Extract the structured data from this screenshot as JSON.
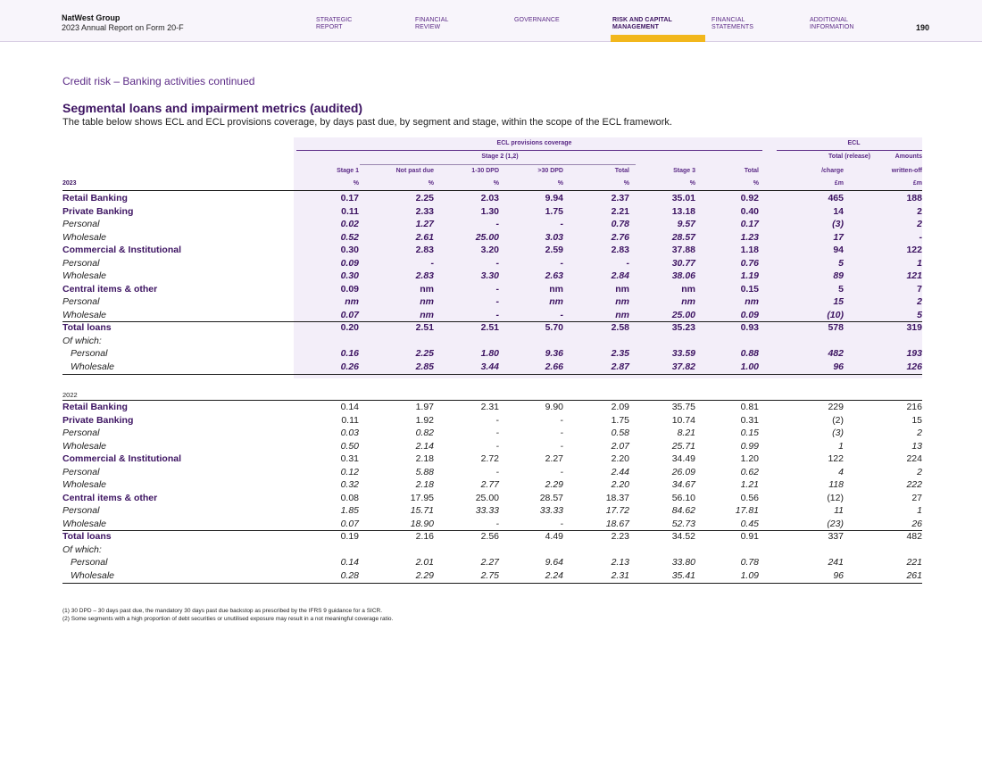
{
  "header": {
    "company": "NatWest Group",
    "report": "2023 Annual Report on Form 20-F",
    "page_number": "190",
    "nav": [
      {
        "label_1": "STRATEGIC",
        "label_2": "REPORT"
      },
      {
        "label_1": "FINANCIAL",
        "label_2": "REVIEW"
      },
      {
        "label_1": "",
        "label_2": "GOVERNANCE"
      },
      {
        "label_1": "RISK AND CAPITAL",
        "label_2": "MANAGEMENT"
      },
      {
        "label_1": "FINANCIAL",
        "label_2": "STATEMENTS"
      },
      {
        "label_1": "ADDITIONAL",
        "label_2": "INFORMATION"
      }
    ],
    "active_color": "#f2b71c"
  },
  "section_title": "Credit risk – Banking activities continued",
  "table_title": "Segmental loans and impairment metrics (audited)",
  "table_desc": "The table below shows ECL and ECL provisions coverage, by days past due, by segment and stage, within the scope of the ECL framework.",
  "table": {
    "group_ecl_coverage": "ECL provisions coverage",
    "group_stage2": "Stage 2 (1,2)",
    "group_ecl": "ECL",
    "columns": [
      {
        "h1": "",
        "h2": "Stage 1",
        "unit": "%"
      },
      {
        "h1": "",
        "h2": "Not past due",
        "unit": "%"
      },
      {
        "h1": "",
        "h2": "1-30 DPD",
        "unit": "%"
      },
      {
        "h1": "",
        "h2": ">30 DPD",
        "unit": "%"
      },
      {
        "h1": "",
        "h2": "Total",
        "unit": "%"
      },
      {
        "h1": "",
        "h2": "Stage 3",
        "unit": "%"
      },
      {
        "h1": "",
        "h2": "Total",
        "unit": "%"
      },
      {
        "h1": "Total (release)",
        "h2": "/charge",
        "unit": "£m"
      },
      {
        "h1": "Amounts",
        "h2": "written-off",
        "unit": "£m"
      }
    ],
    "year_2023": "2023",
    "year_2022": "2022",
    "rows_2023": [
      {
        "label": "Retail Banking",
        "type": "seg",
        "values": [
          "0.17",
          "2.25",
          "2.03",
          "9.94",
          "2.37",
          "35.01",
          "0.92",
          "465",
          "188"
        ]
      },
      {
        "label": "Private Banking",
        "type": "seg",
        "values": [
          "0.11",
          "2.33",
          "1.30",
          "1.75",
          "2.21",
          "13.18",
          "0.40",
          "14",
          "2"
        ]
      },
      {
        "label": "Personal",
        "type": "sub",
        "values": [
          "0.02",
          "1.27",
          "-",
          "-",
          "0.78",
          "9.57",
          "0.17",
          "(3)",
          "2"
        ]
      },
      {
        "label": "Wholesale",
        "type": "sub",
        "values": [
          "0.52",
          "2.61",
          "25.00",
          "3.03",
          "2.76",
          "28.57",
          "1.23",
          "17",
          "-"
        ]
      },
      {
        "label": "Commercial & Institutional",
        "type": "seg",
        "values": [
          "0.30",
          "2.83",
          "3.20",
          "2.59",
          "2.83",
          "37.88",
          "1.18",
          "94",
          "122"
        ]
      },
      {
        "label": "Personal",
        "type": "sub",
        "values": [
          "0.09",
          "-",
          "-",
          "-",
          "-",
          "30.77",
          "0.76",
          "5",
          "1"
        ]
      },
      {
        "label": "Wholesale",
        "type": "sub",
        "values": [
          "0.30",
          "2.83",
          "3.30",
          "2.63",
          "2.84",
          "38.06",
          "1.19",
          "89",
          "121"
        ]
      },
      {
        "label": "Central items & other",
        "type": "seg",
        "values": [
          "0.09",
          "nm",
          "-",
          "nm",
          "nm",
          "nm",
          "0.15",
          "5",
          "7"
        ]
      },
      {
        "label": "Personal",
        "type": "sub",
        "values": [
          "nm",
          "nm",
          "-",
          "nm",
          "nm",
          "nm",
          "nm",
          "15",
          "2"
        ]
      },
      {
        "label": "Wholesale",
        "type": "sub",
        "values": [
          "0.07",
          "nm",
          "-",
          "-",
          "nm",
          "25.00",
          "0.09",
          "(10)",
          "5"
        ]
      },
      {
        "label": "Total loans",
        "type": "seg",
        "values": [
          "0.20",
          "2.51",
          "2.51",
          "5.70",
          "2.58",
          "35.23",
          "0.93",
          "578",
          "319"
        ]
      },
      {
        "label": "Of which:",
        "type": "ofwhich",
        "values": [
          "",
          "",
          "",
          "",
          "",
          "",
          "",
          "",
          ""
        ]
      },
      {
        "label": "Personal",
        "type": "sub indent",
        "values": [
          "0.16",
          "2.25",
          "1.80",
          "9.36",
          "2.35",
          "33.59",
          "0.88",
          "482",
          "193"
        ]
      },
      {
        "label": "Wholesale",
        "type": "sub indent",
        "values": [
          "0.26",
          "2.85",
          "3.44",
          "2.66",
          "2.87",
          "37.82",
          "1.00",
          "96",
          "126"
        ]
      }
    ],
    "rows_2022": [
      {
        "label": "Retail Banking",
        "type": "seg",
        "values": [
          "0.14",
          "1.97",
          "2.31",
          "9.90",
          "2.09",
          "35.75",
          "0.81",
          "229",
          "216"
        ]
      },
      {
        "label": "Private Banking",
        "type": "seg",
        "values": [
          "0.11",
          "1.92",
          "-",
          "-",
          "1.75",
          "10.74",
          "0.31",
          "(2)",
          "15"
        ]
      },
      {
        "label": "Personal",
        "type": "sub",
        "values": [
          "0.03",
          "0.82",
          "-",
          "-",
          "0.58",
          "8.21",
          "0.15",
          "(3)",
          "2"
        ]
      },
      {
        "label": "Wholesale",
        "type": "sub",
        "values": [
          "0.50",
          "2.14",
          "-",
          "-",
          "2.07",
          "25.71",
          "0.99",
          "1",
          "13"
        ]
      },
      {
        "label": "Commercial & Institutional",
        "type": "seg",
        "values": [
          "0.31",
          "2.18",
          "2.72",
          "2.27",
          "2.20",
          "34.49",
          "1.20",
          "122",
          "224"
        ]
      },
      {
        "label": "Personal",
        "type": "sub",
        "values": [
          "0.12",
          "5.88",
          "-",
          "-",
          "2.44",
          "26.09",
          "0.62",
          "4",
          "2"
        ]
      },
      {
        "label": "Wholesale",
        "type": "sub",
        "values": [
          "0.32",
          "2.18",
          "2.77",
          "2.29",
          "2.20",
          "34.67",
          "1.21",
          "118",
          "222"
        ]
      },
      {
        "label": "Central items & other",
        "type": "seg",
        "values": [
          "0.08",
          "17.95",
          "25.00",
          "28.57",
          "18.37",
          "56.10",
          "0.56",
          "(12)",
          "27"
        ]
      },
      {
        "label": "Personal",
        "type": "sub",
        "values": [
          "1.85",
          "15.71",
          "33.33",
          "33.33",
          "17.72",
          "84.62",
          "17.81",
          "11",
          "1"
        ]
      },
      {
        "label": "Wholesale",
        "type": "sub",
        "values": [
          "0.07",
          "18.90",
          "-",
          "-",
          "18.67",
          "52.73",
          "0.45",
          "(23)",
          "26"
        ]
      },
      {
        "label": "Total loans",
        "type": "seg",
        "values": [
          "0.19",
          "2.16",
          "2.56",
          "4.49",
          "2.23",
          "34.52",
          "0.91",
          "337",
          "482"
        ]
      },
      {
        "label": "Of which:",
        "type": "ofwhich",
        "values": [
          "",
          "",
          "",
          "",
          "",
          "",
          "",
          "",
          ""
        ]
      },
      {
        "label": "Personal",
        "type": "sub indent",
        "values": [
          "0.14",
          "2.01",
          "2.27",
          "9.64",
          "2.13",
          "33.80",
          "0.78",
          "241",
          "221"
        ]
      },
      {
        "label": "Wholesale",
        "type": "sub indent",
        "values": [
          "0.28",
          "2.29",
          "2.75",
          "2.24",
          "2.31",
          "35.41",
          "1.09",
          "96",
          "261"
        ]
      }
    ]
  },
  "footnotes": [
    "(1)   30 DPD – 30 days past due, the mandatory 30 days past due backstop as prescribed by the IFRS 9 guidance for a SICR.",
    "(2)   Some segments with a high proportion of debt securities or unutilised exposure may result in a not meaningful coverage ratio."
  ]
}
